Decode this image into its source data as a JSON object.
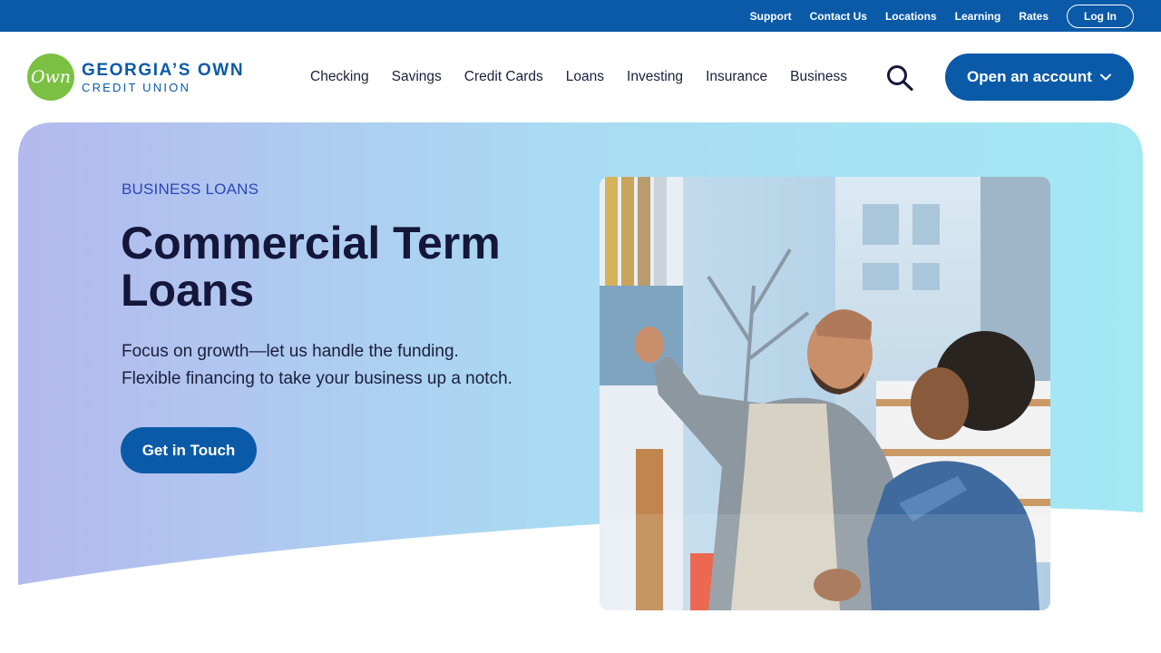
{
  "utility": {
    "links": [
      "Support",
      "Contact Us",
      "Locations",
      "Learning",
      "Rates"
    ],
    "login_label": "Log In"
  },
  "brand": {
    "logo_mark": "Own",
    "name_line1": "GEORGIA’S OWN",
    "name_line2": "CREDIT UNION",
    "primary_color": "#0a5aa8",
    "logo_green": "#7bc043"
  },
  "nav": {
    "items": [
      "Checking",
      "Savings",
      "Credit Cards",
      "Loans",
      "Investing",
      "Insurance",
      "Business"
    ],
    "search_icon": "search-icon",
    "open_account_label": "Open an account",
    "open_account_icon": "chevron-down-icon"
  },
  "hero": {
    "eyebrow": "BUSINESS LOANS",
    "title": "Commercial Term Loans",
    "subtitle_line1": "Focus on growth—let us handle the funding.",
    "subtitle_line2": "Flexible financing to take your business up a notch.",
    "cta_label": "Get in Touch",
    "gradient_start": "#b4b9ee",
    "gradient_end": "#a4e8f4"
  }
}
